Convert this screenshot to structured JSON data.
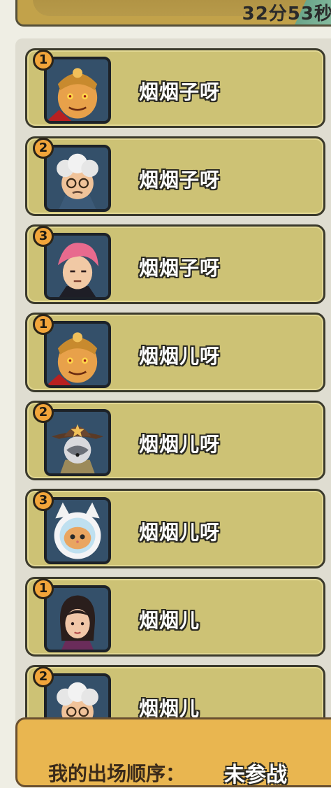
{
  "header": {
    "timer_text": "32分53秒",
    "colors": {
      "banner": "#c2a24a",
      "accent": "#8fc3a6"
    }
  },
  "entries": [
    {
      "rank": "1",
      "name": "烟烟子呀",
      "avatar": "golden-warrior-avatar"
    },
    {
      "rank": "2",
      "name": "烟烟子呀",
      "avatar": "white-hair-elder-avatar"
    },
    {
      "rank": "3",
      "name": "烟烟子呀",
      "avatar": "pink-hair-man-avatar"
    },
    {
      "rank": "1",
      "name": "烟烟儿呀",
      "avatar": "golden-warrior-avatar"
    },
    {
      "rank": "2",
      "name": "烟烟儿呀",
      "avatar": "cowboy-husky-avatar"
    },
    {
      "rank": "3",
      "name": "烟烟儿呀",
      "avatar": "astronaut-cat-avatar"
    },
    {
      "rank": "1",
      "name": "烟烟儿",
      "avatar": "dark-hair-woman-avatar"
    },
    {
      "rank": "2",
      "name": "烟烟儿",
      "avatar": "white-hair-elder-avatar"
    }
  ],
  "footer": {
    "order_label": "我的出场顺序：",
    "order_value": "未参战"
  },
  "colors": {
    "card_bg": "#cdc275",
    "badge": "#f2a53a",
    "footer_bg": "#e9b650"
  }
}
